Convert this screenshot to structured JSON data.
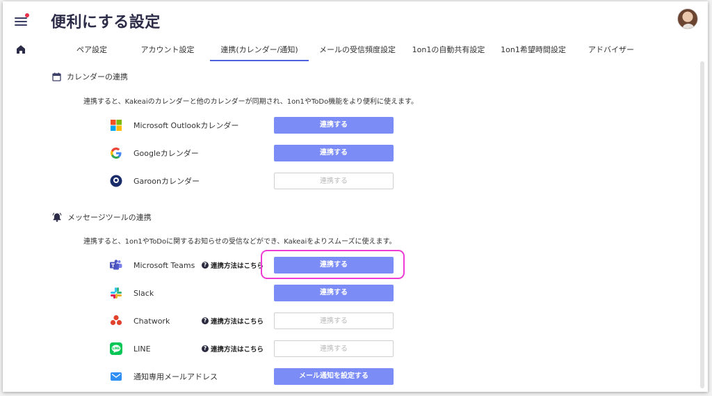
{
  "page": {
    "title": "便利にする設定"
  },
  "tabs": [
    {
      "label": "ペア設定",
      "active": false
    },
    {
      "label": "アカウント設定",
      "active": false
    },
    {
      "label": "連携(カレンダー/通知)",
      "active": true
    },
    {
      "label": "メールの受信頻度設定",
      "active": false
    },
    {
      "label": "1on1の自動共有設定",
      "active": false
    },
    {
      "label": "1on1希望時間設定",
      "active": false
    },
    {
      "label": "アドバイザー",
      "active": false
    }
  ],
  "calendar_section": {
    "title": "カレンダーの連携",
    "icon": "calendar-icon",
    "description": "連携すると、Kakeaiのカレンダーと他のカレンダーが同期され、1on1やToDo機能をより便利に使えます。",
    "services": [
      {
        "name": "Microsoft Outlookカレンダー",
        "icon": "microsoft-logo-icon",
        "button": "連携する",
        "enabled": true
      },
      {
        "name": "Googleカレンダー",
        "icon": "google-logo-icon",
        "button": "連携する",
        "enabled": true
      },
      {
        "name": "Garoonカレンダー",
        "icon": "garoon-logo-icon",
        "button": "連携する",
        "enabled": false
      }
    ]
  },
  "message_section": {
    "title": "メッセージツールの連携",
    "icon": "bell-icon",
    "description": "連携すると、1on1やToDoに関するお知らせの受信などができ、Kakeaiをよりスムーズに使えます。",
    "services": [
      {
        "name": "Microsoft Teams",
        "icon": "teams-logo-icon",
        "help": "連携方法はこちら",
        "button": "連携する",
        "enabled": true
      },
      {
        "name": "Slack",
        "icon": "slack-logo-icon",
        "help": "",
        "button": "連携する",
        "enabled": true
      },
      {
        "name": "Chatwork",
        "icon": "chatwork-logo-icon",
        "help": "連携方法はこちら",
        "button": "連携する",
        "enabled": false
      },
      {
        "name": "LINE",
        "icon": "line-logo-icon",
        "help": "連携方法はこちら",
        "button": "連携する",
        "enabled": false
      },
      {
        "name": "通知専用メールアドレス",
        "icon": "mail-icon",
        "help": "",
        "button": "メール通知を設定する",
        "enabled": true
      }
    ]
  },
  "colors": {
    "primary": "#7b8cf7",
    "tab_active": "#4b61dd",
    "highlight": "#ee3bd6",
    "notification_dot": "#e8304a"
  }
}
